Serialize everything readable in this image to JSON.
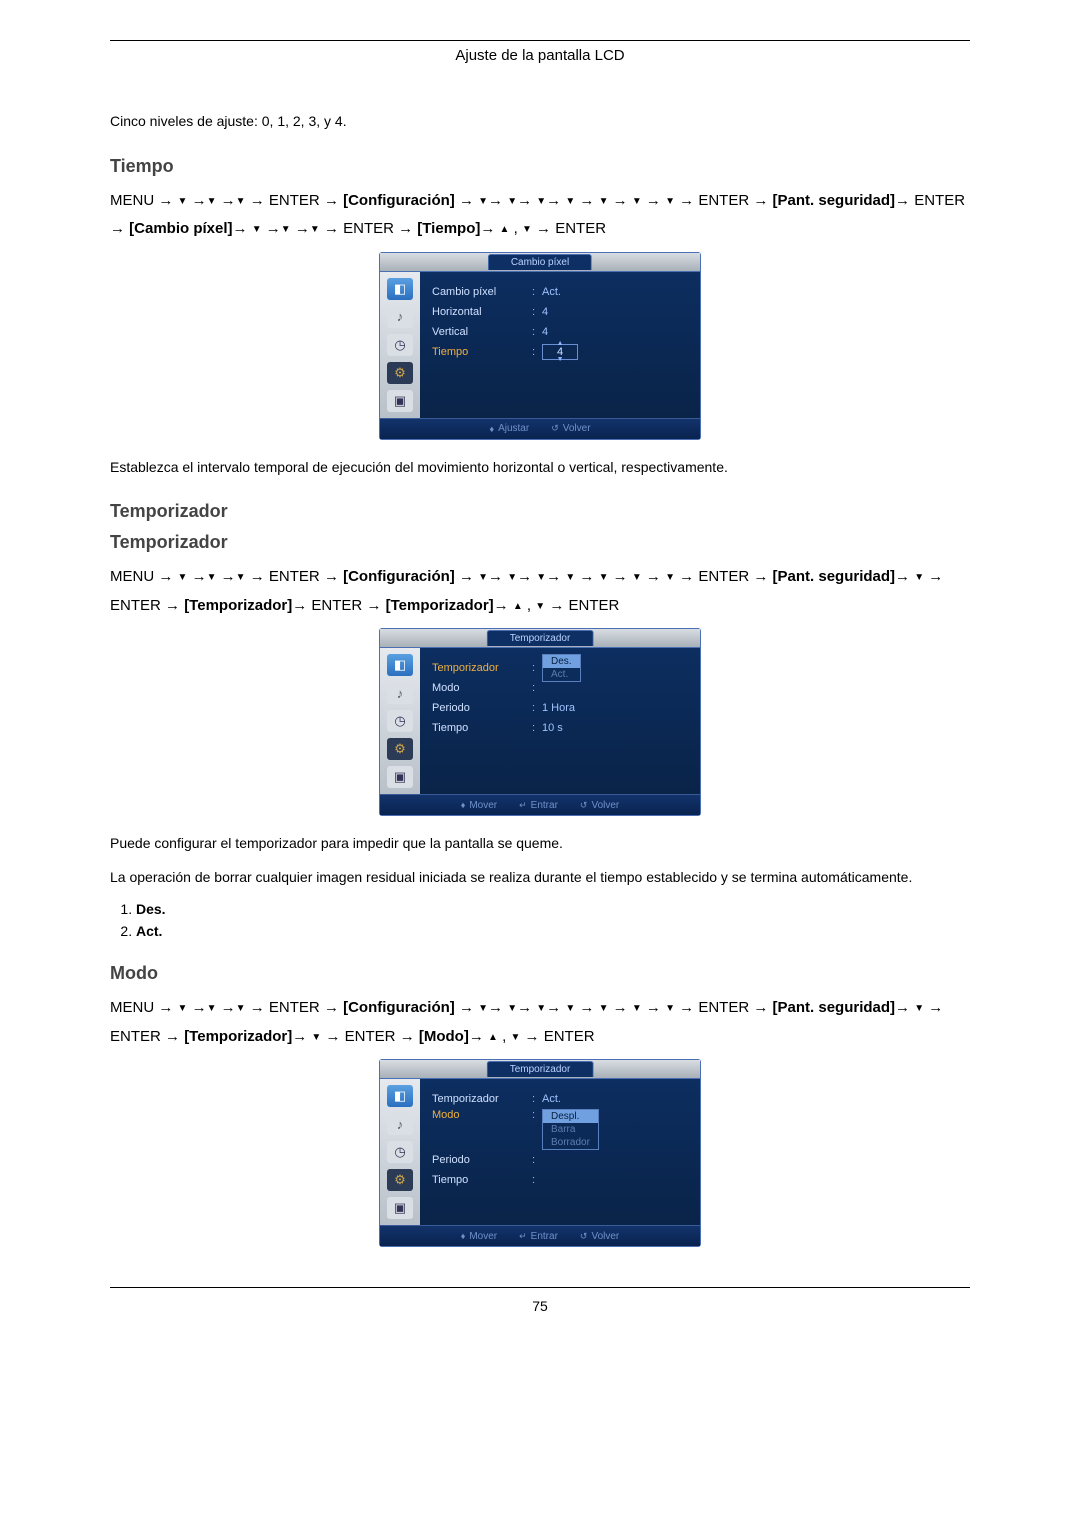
{
  "header": {
    "title": "Ajuste de la pantalla LCD"
  },
  "intro": {
    "levels_text": "Cinco niveles de ajuste: 0, 1, 2, 3, y 4."
  },
  "tiempo": {
    "heading": "Tiempo",
    "nav": {
      "menu": "MENU",
      "enter": "ENTER",
      "b1": "[Configuración]",
      "b2": "[Pant. seguridad]",
      "b3": "[Cambio píxel]",
      "b4": "[Tiempo]"
    },
    "osd": {
      "tab": "Cambio píxel",
      "rows": {
        "r1l": "Cambio píxel",
        "r1v": "Act.",
        "r2l": "Horizontal",
        "r2v": "4",
        "r3l": "Vertical",
        "r3v": "4",
        "r4l": "Tiempo",
        "r4v": "4"
      },
      "foot": {
        "ajustar": "Ajustar",
        "volver": "Volver"
      }
    },
    "desc": "Establezca el intervalo temporal de ejecución del movimiento horizontal o vertical, respectivamente."
  },
  "temporizador": {
    "heading1": "Temporizador",
    "heading2": "Temporizador",
    "nav": {
      "menu": "MENU",
      "enter": "ENTER",
      "b1": "[Configuración]",
      "b2": "[Pant. seguridad]",
      "b3": "[Temporizador]",
      "b4": "[Temporizador]"
    },
    "osd": {
      "tab": "Temporizador",
      "rows": {
        "r1l": "Temporizador",
        "r1va": "Des.",
        "r1vb": "Act.",
        "r2l": "Modo",
        "r3l": "Periodo",
        "r3v": "1 Hora",
        "r4l": "Tiempo",
        "r4v": "10 s"
      },
      "foot": {
        "mover": "Mover",
        "entrar": "Entrar",
        "volver": "Volver"
      }
    },
    "desc1": "Puede configurar el temporizador para impedir que la pantalla se queme.",
    "desc2": "La operación de borrar cualquier imagen residual iniciada se realiza durante el tiempo establecido y se termina automáticamente.",
    "opts": {
      "o1": "Des.",
      "o2": "Act."
    }
  },
  "modo": {
    "heading": "Modo",
    "nav": {
      "menu": "MENU",
      "enter": "ENTER",
      "b1": "[Configuración]",
      "b2": "[Pant. seguridad]",
      "b3": "[Temporizador]",
      "b4": "[Modo]"
    },
    "osd": {
      "tab": "Temporizador",
      "rows": {
        "r1l": "Temporizador",
        "r1v": "Act.",
        "r2l": "Modo",
        "r2va": "Despl.",
        "r2vb": "Barra",
        "r2vc": "Borrador",
        "r3l": "Periodo",
        "r4l": "Tiempo"
      },
      "foot": {
        "mover": "Mover",
        "entrar": "Entrar",
        "volver": "Volver"
      }
    }
  },
  "page_number": "75",
  "glyphs": {
    "arrow": "→",
    "down": "▼",
    "up": "▲",
    "updown": "♦",
    "ret": "↵",
    "back": "↺"
  }
}
